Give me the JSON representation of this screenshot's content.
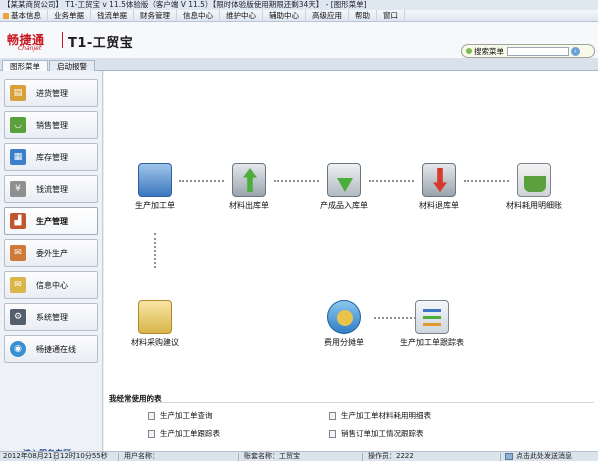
{
  "window": {
    "title": "【某某商贸公司】 T1-工贸宝 v 11.5体验版（客户端 V 11.5）【限时体验版使用期限还剩34天】 - [图形菜单]"
  },
  "menubar": {
    "items": [
      "基本信息",
      "业务单据",
      "钱流单据",
      "财务管理",
      "信息中心",
      "维护中心",
      "辅助中心",
      "高级应用",
      "帮助",
      "窗口"
    ]
  },
  "brand": {
    "logo_cn": "畅捷通",
    "logo_en": "Chanjet",
    "product": "T1-工贸宝"
  },
  "search": {
    "label": "搜索菜单",
    "value": "",
    "placeholder": ""
  },
  "tabs": [
    {
      "label": "图形菜单",
      "active": true
    },
    {
      "label": "启动报警",
      "active": false
    }
  ],
  "sidebar": {
    "items": [
      {
        "label": "进货管理",
        "icon": "clipboard-icon"
      },
      {
        "label": "销售管理",
        "icon": "basket-icon"
      },
      {
        "label": "库存管理",
        "icon": "inventory-icon"
      },
      {
        "label": "钱流管理",
        "icon": "money-icon"
      },
      {
        "label": "生产管理",
        "icon": "factory-icon",
        "active": true
      },
      {
        "label": "委外生产",
        "icon": "outsource-icon"
      },
      {
        "label": "信息中心",
        "icon": "envelope-icon"
      },
      {
        "label": "系统管理",
        "icon": "system-icon"
      },
      {
        "label": "畅捷通在线",
        "icon": "globe-icon"
      }
    ],
    "service_link": "进入服务专区"
  },
  "flow": {
    "nodes": [
      {
        "label": "生产加工单",
        "icon": "production-order-icon"
      },
      {
        "label": "材料出库单",
        "icon": "material-out-icon"
      },
      {
        "label": "产成品入库单",
        "icon": "product-in-icon"
      },
      {
        "label": "材料退库单",
        "icon": "material-return-icon"
      },
      {
        "label": "材料耗用明细账",
        "icon": "material-ledger-icon"
      },
      {
        "label": "材料采购建议",
        "icon": "purchase-advice-icon"
      },
      {
        "label": "费用分摊单",
        "icon": "cost-allocation-icon"
      },
      {
        "label": "生产加工单跟踪表",
        "icon": "tracking-icon"
      }
    ]
  },
  "favorites": {
    "title": "我经常使用的表",
    "links": [
      "生产加工单查询",
      "生产加工单材料耗用明细表",
      "生产加工单跟踪表",
      "销售订单加工情况跟踪表"
    ]
  },
  "status": {
    "date": "2012年08月21日",
    "time": "12时10分55秒",
    "user_label": "用户名称：",
    "user_value": "",
    "account": "账套名称：工贸宝",
    "operator": "操作员：2222",
    "message": "点击此处发送消息"
  },
  "colors": {
    "accent_red": "#c8161e",
    "link_blue": "#1b3f8e"
  }
}
